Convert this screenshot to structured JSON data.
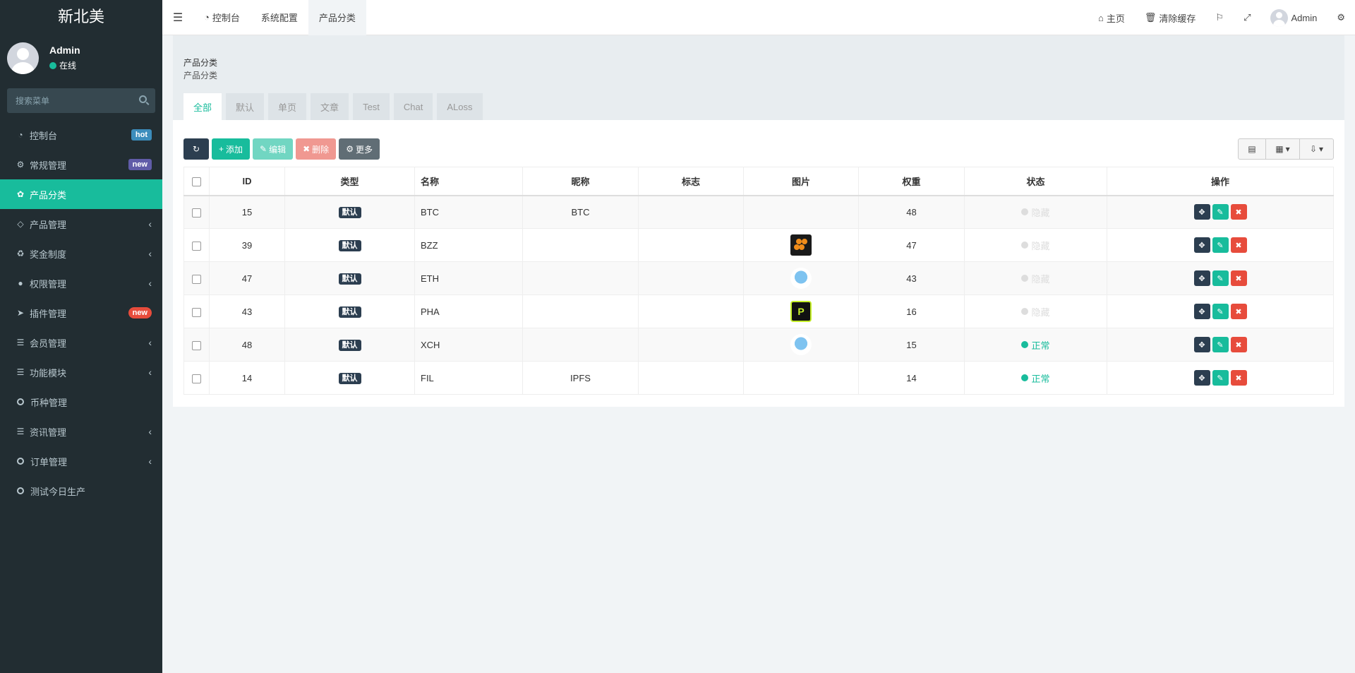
{
  "sidebar": {
    "brand": "新北美",
    "user": {
      "name": "Admin",
      "status": "在线"
    },
    "search_placeholder": "搜索菜单",
    "items": [
      {
        "label": "控制台",
        "icon": "dashboard-icon",
        "badge": "hot"
      },
      {
        "label": "常规管理",
        "icon": "cogs-icon",
        "badge": "new"
      },
      {
        "label": "产品分类",
        "icon": "leaf-icon",
        "active": true
      },
      {
        "label": "产品管理",
        "icon": "diamond-icon"
      },
      {
        "label": "奖金制度",
        "icon": "recycle-icon"
      },
      {
        "label": "权限管理",
        "icon": "group-icon"
      },
      {
        "label": "插件管理",
        "icon": "rocket-icon",
        "badge": "new"
      },
      {
        "label": "会员管理",
        "icon": "list-icon"
      },
      {
        "label": "功能模块",
        "icon": "list-icon"
      },
      {
        "label": "币种管理",
        "icon": "circle-icon"
      },
      {
        "label": "资讯管理",
        "icon": "list-icon"
      },
      {
        "label": "订单管理",
        "icon": "circle-icon"
      },
      {
        "label": "测试今日生产",
        "icon": "circle-icon"
      }
    ]
  },
  "header": {
    "tabs": [
      "控制台",
      "系统配置",
      "产品分类"
    ],
    "right": {
      "home": "主页",
      "clear_cache": "清除缓存",
      "user": "Admin"
    }
  },
  "content": {
    "title": "产品分类",
    "subtitle": "产品分类",
    "sub_tabs": [
      "全部",
      "默认",
      "单页",
      "文章",
      "Test",
      "Chat",
      "ALoss"
    ]
  },
  "toolbar": {
    "add": "添加",
    "edit": "编辑",
    "delete": "删除",
    "more": "更多"
  },
  "table": {
    "columns": [
      "ID",
      "类型",
      "名称",
      "昵称",
      "标志",
      "图片",
      "权重",
      "状态",
      "操作"
    ],
    "rows": [
      {
        "id": "15",
        "type": "默认",
        "name": "BTC",
        "nickname": "BTC",
        "flag": "",
        "image": "",
        "weight": "48",
        "status": "隐藏",
        "status_type": "hidden"
      },
      {
        "id": "39",
        "type": "默认",
        "name": "BZZ",
        "nickname": "",
        "flag": "",
        "image": "bzz",
        "weight": "47",
        "status": "隐藏",
        "status_type": "hidden"
      },
      {
        "id": "47",
        "type": "默认",
        "name": "ETH",
        "nickname": "",
        "flag": "",
        "image": "eth",
        "weight": "43",
        "status": "隐藏",
        "status_type": "hidden"
      },
      {
        "id": "43",
        "type": "默认",
        "name": "PHA",
        "nickname": "",
        "flag": "",
        "image": "pha",
        "weight": "16",
        "status": "隐藏",
        "status_type": "hidden"
      },
      {
        "id": "48",
        "type": "默认",
        "name": "XCH",
        "nickname": "",
        "flag": "",
        "image": "eth",
        "weight": "15",
        "status": "正常",
        "status_type": "normal"
      },
      {
        "id": "14",
        "type": "默认",
        "name": "FIL",
        "nickname": "IPFS",
        "flag": "",
        "image": "",
        "weight": "14",
        "status": "正常",
        "status_type": "normal"
      }
    ]
  },
  "colors": {
    "accent": "#18bc9c",
    "sidebar_bg": "#222d32",
    "danger": "#e74c3c",
    "dark": "#2c3e50"
  }
}
